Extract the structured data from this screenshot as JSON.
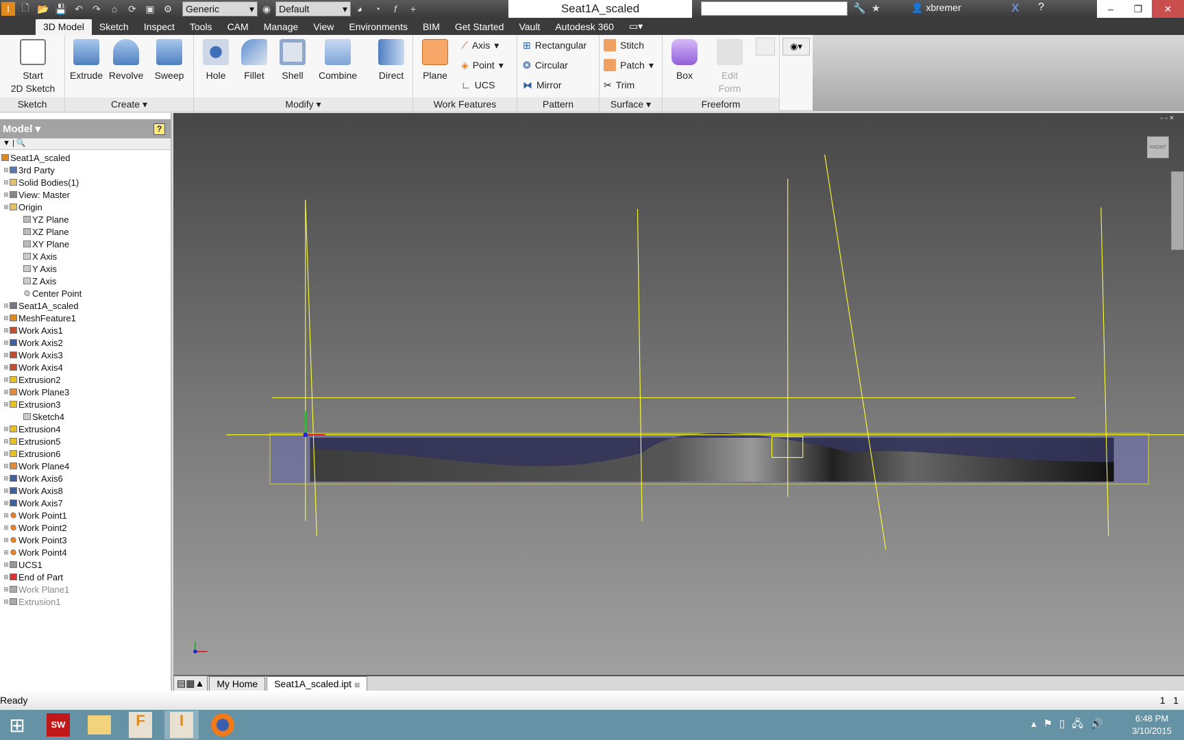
{
  "app": {
    "title": "Seat1A_scaled",
    "user": "xbremer",
    "material": "Generic",
    "appearance": "Default"
  },
  "tabs": [
    "3D Model",
    "Sketch",
    "Inspect",
    "Tools",
    "CAM",
    "Manage",
    "View",
    "Environments",
    "BIM",
    "Get Started",
    "Vault",
    "Autodesk 360"
  ],
  "ribbon": {
    "sketch": {
      "label": "Sketch",
      "start": "Start",
      "start2": "2D Sketch"
    },
    "create": {
      "label": "Create ▾",
      "buttons": [
        "Extrude",
        "Revolve",
        "Sweep"
      ]
    },
    "modify": {
      "label": "Modify ▾",
      "buttons": [
        "Hole",
        "Fillet",
        "Shell",
        "Combine",
        "Direct"
      ]
    },
    "work": {
      "label": "Work Features",
      "plane": "Plane",
      "axis": "Axis",
      "point": "Point",
      "ucs": "UCS"
    },
    "pattern": {
      "label": "Pattern",
      "items": [
        "Rectangular",
        "Circular",
        "Mirror"
      ]
    },
    "surface": {
      "label": "Surface ▾",
      "items": [
        "Stitch",
        "Patch",
        "Trim"
      ]
    },
    "freeform": {
      "label": "Freeform",
      "box": "Box",
      "edit1": "Edit",
      "edit2": "Form"
    }
  },
  "browser": {
    "title": "Model ▾",
    "items": [
      {
        "label": "Seat1A_scaled",
        "level": 0,
        "icon": "part",
        "color": "#e08a1e"
      },
      {
        "label": "3rd Party",
        "level": 1,
        "icon": "folder",
        "color": "#5a7ab0"
      },
      {
        "label": "Solid Bodies(1)",
        "level": 1,
        "icon": "folder",
        "color": "#e0c070"
      },
      {
        "label": "View: Master",
        "level": 1,
        "icon": "view",
        "color": "#888"
      },
      {
        "label": "Origin",
        "level": 1,
        "icon": "folder",
        "color": "#e8c060"
      },
      {
        "label": "YZ Plane",
        "level": 2,
        "icon": "plane",
        "color": "#bbb"
      },
      {
        "label": "XZ Plane",
        "level": 2,
        "icon": "plane",
        "color": "#bbb"
      },
      {
        "label": "XY Plane",
        "level": 2,
        "icon": "plane",
        "color": "#bbb"
      },
      {
        "label": "X Axis",
        "level": 2,
        "icon": "axis",
        "color": "#ccc"
      },
      {
        "label": "Y Axis",
        "level": 2,
        "icon": "axis",
        "color": "#ccc"
      },
      {
        "label": "Z Axis",
        "level": 2,
        "icon": "axis",
        "color": "#ccc"
      },
      {
        "label": "Center Point",
        "level": 2,
        "icon": "point",
        "color": "#ccc"
      },
      {
        "label": "Seat1A_scaled",
        "level": 1,
        "icon": "mesh",
        "color": "#778"
      },
      {
        "label": "MeshFeature1",
        "level": 1,
        "icon": "part",
        "color": "#e08a1e"
      },
      {
        "label": "Work Axis1",
        "level": 1,
        "icon": "axis",
        "color": "#c05030"
      },
      {
        "label": "Work Axis2",
        "level": 1,
        "icon": "axis",
        "color": "#4060a0"
      },
      {
        "label": "Work Axis3",
        "level": 1,
        "icon": "axis",
        "color": "#c05030"
      },
      {
        "label": "Work Axis4",
        "level": 1,
        "icon": "axis",
        "color": "#c05030"
      },
      {
        "label": "Extrusion2",
        "level": 1,
        "icon": "extrude",
        "color": "#e8c020"
      },
      {
        "label": "Work Plane3",
        "level": 1,
        "icon": "plane",
        "color": "#e08a40"
      },
      {
        "label": "Extrusion3",
        "level": 1,
        "icon": "extrude",
        "color": "#e8c020"
      },
      {
        "label": "Sketch4",
        "level": 2,
        "icon": "sketch",
        "color": "#ccc"
      },
      {
        "label": "Extrusion4",
        "level": 1,
        "icon": "extrude",
        "color": "#e8c020"
      },
      {
        "label": "Extrusion5",
        "level": 1,
        "icon": "extrude",
        "color": "#e8c020"
      },
      {
        "label": "Extrusion6",
        "level": 1,
        "icon": "extrude",
        "color": "#e8c020"
      },
      {
        "label": "Work Plane4",
        "level": 1,
        "icon": "plane",
        "color": "#e08a40"
      },
      {
        "label": "Work Axis6",
        "level": 1,
        "icon": "axis",
        "color": "#4060a0"
      },
      {
        "label": "Work Axis8",
        "level": 1,
        "icon": "axis",
        "color": "#4060a0"
      },
      {
        "label": "Work Axis7",
        "level": 1,
        "icon": "axis",
        "color": "#4060a0"
      },
      {
        "label": "Work Point1",
        "level": 1,
        "icon": "point",
        "color": "#f08020"
      },
      {
        "label": "Work Point2",
        "level": 1,
        "icon": "point",
        "color": "#f08020"
      },
      {
        "label": "Work Point3",
        "level": 1,
        "icon": "point",
        "color": "#f08020"
      },
      {
        "label": "Work Point4",
        "level": 1,
        "icon": "point",
        "color": "#f08020"
      },
      {
        "label": "UCS1",
        "level": 1,
        "icon": "ucs",
        "color": "#999"
      },
      {
        "label": "End of Part",
        "level": 1,
        "icon": "end",
        "color": "#e03030"
      },
      {
        "label": "Work Plane1",
        "level": 1,
        "icon": "plane",
        "color": "#aaa",
        "dim": true
      },
      {
        "label": "Extrusion1",
        "level": 1,
        "icon": "extrude",
        "color": "#aaa",
        "dim": true
      }
    ]
  },
  "viewcube": "FRONT",
  "doc_tabs": [
    "My Home",
    "Seat1A_scaled.ipt"
  ],
  "status": {
    "text": "Ready",
    "n1": "1",
    "n2": "1"
  },
  "clock": {
    "time": "6:48 PM",
    "date": "3/10/2015"
  },
  "colors": {
    "accent": "#e08a1e",
    "work_geometry": "#ffff00",
    "taskbar": "#6593a5",
    "close": "#c94f4f"
  }
}
